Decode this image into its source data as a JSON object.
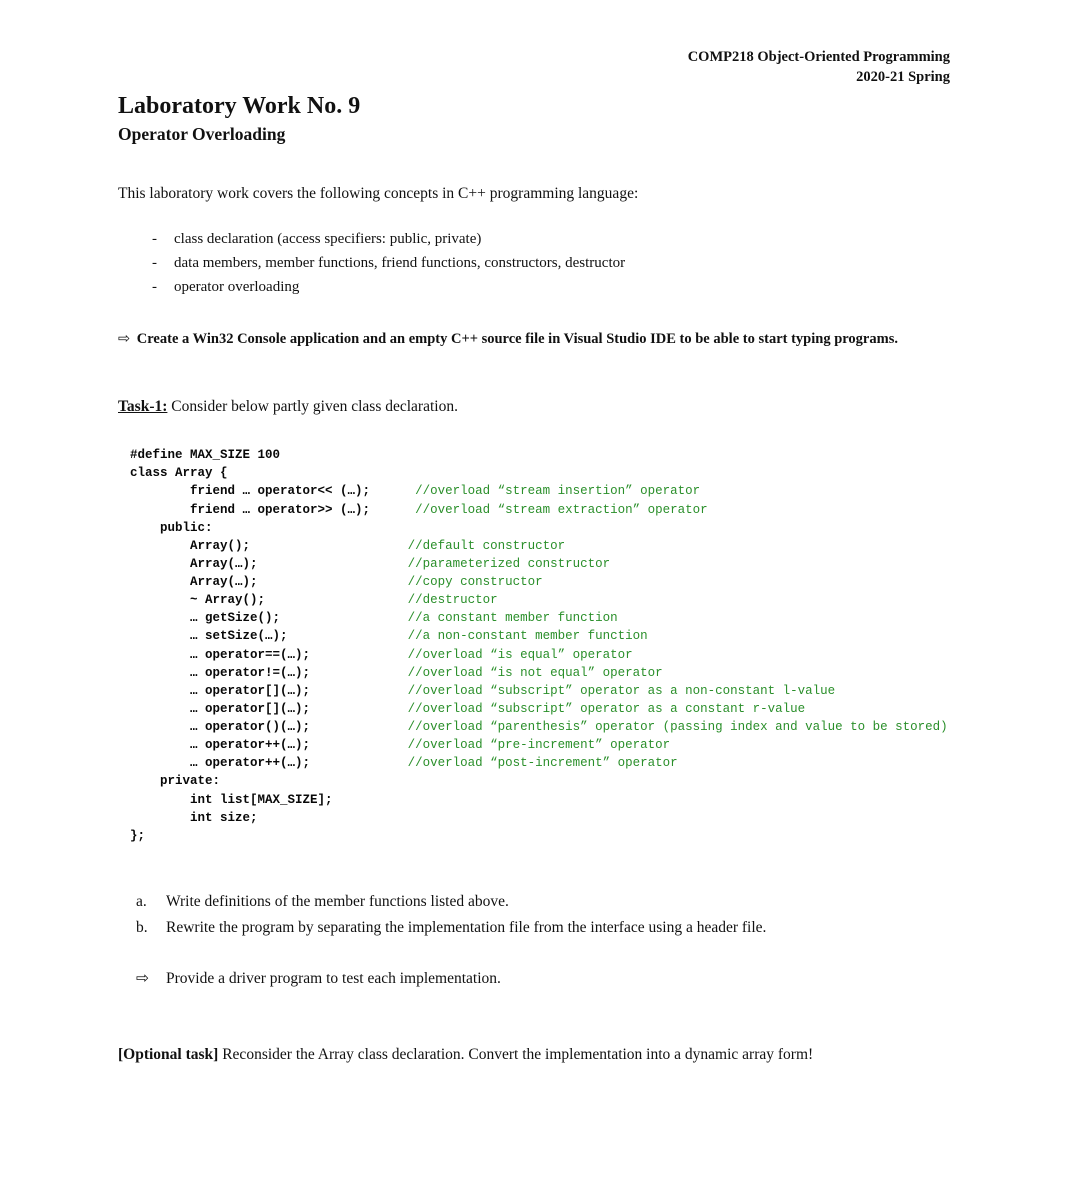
{
  "header": {
    "line1": "COMP218 Object-Oriented Programming",
    "line2": "2020-21 Spring"
  },
  "title": "Laboratory Work No. 9",
  "subtitle": "Operator Overloading",
  "intro": "This laboratory work covers the following concepts in C++ programming language:",
  "concepts": [
    "class declaration (access specifiers: public, private)",
    "data members, member functions, friend functions, constructors, destructor",
    "operator overloading"
  ],
  "instruction_arrow": "⇨",
  "instruction": "Create a Win32 Console application and an empty C++ source file in Visual Studio IDE to be able to start typing programs.",
  "task_label": "Task-1:",
  "task_text": " Consider below partly given class declaration.",
  "code": {
    "l1": "#define MAX_SIZE 100",
    "l2": "class Array {",
    "l3a": "        friend … operator<< (…);",
    "l3b": "//overload “stream insertion” operator",
    "l4a": "        friend … operator>> (…);",
    "l4b": "//overload “stream extraction” operator",
    "l5": "    public:",
    "l6a": "        Array();",
    "l6b": "//default constructor",
    "l7a": "        Array(…);",
    "l7b": "//parameterized constructor",
    "l8a": "        Array(…);",
    "l8b": "//copy constructor",
    "l9a": "        ~ Array();",
    "l9b": "//destructor",
    "l10a": "        … getSize();",
    "l10b": "//a constant member function",
    "l11a": "        … setSize(…);",
    "l11b": "//a non-constant member function",
    "l12a": "        … operator==(…);",
    "l12b": "//overload “is equal” operator",
    "l13a": "        … operator!=(…);",
    "l13b": "//overload “is not equal” operator",
    "l14a": "        … operator[](…);",
    "l14b": "//overload “subscript” operator as a non-constant l-value",
    "l15a": "        … operator[](…);",
    "l15b": "//overload “subscript” operator as a constant r-value",
    "l16a": "        … operator()(…);",
    "l16b": "//overload “parenthesis” operator (passing index and value to be stored)",
    "l17a": "        … operator++(…);",
    "l17b": "//overload “pre-increment” operator",
    "l18a": "        … operator++(…);",
    "l18b": "//overload “post-increment” operator",
    "l19": "    private:",
    "l20": "        int list[MAX_SIZE];",
    "l21": "        int size;",
    "l22": "};"
  },
  "sub_a_mk": "a.",
  "sub_a": "Write definitions of the member functions listed above.",
  "sub_b_mk": "b.",
  "sub_b": "Rewrite the program by separating the implementation file from the interface using a header file.",
  "driver_arrow": "⇨",
  "driver": "Provide a driver program to test each implementation.",
  "optional_label": "[Optional task]",
  "optional_text": " Reconsider the Array class declaration. Convert the implementation into a dynamic array form!"
}
